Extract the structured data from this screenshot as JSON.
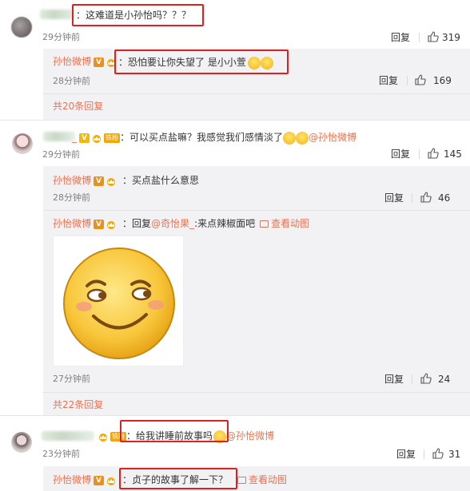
{
  "comments": [
    {
      "text": "：这难道是小孙怡吗？？？",
      "time": "29分钟前",
      "reply_label": "回复",
      "likes": "319",
      "replies": [
        {
          "user": "孙怡微博",
          "text": "：恐怕要让你失望了 是小小萱",
          "time": "28分钟前",
          "reply_label": "回复",
          "likes": "169"
        }
      ],
      "more_replies": "共20条回复"
    },
    {
      "username_suffix": "_",
      "fan_badge": "铁粉",
      "text": "：可以买点盐嘛？我感觉我们感情淡了",
      "mention": "@孙怡微博",
      "time": "29分钟前",
      "reply_label": "回复",
      "likes": "145",
      "replies": [
        {
          "user": "孙怡微博",
          "text": "：买点盐什么意思",
          "time": "28分钟前",
          "reply_label": "回复",
          "likes": "46"
        },
        {
          "user": "孙怡微博",
          "text_prefix": "：回复",
          "mention": "@奇怡果_",
          "text": ":来点辣椒面吧",
          "view_image": "查看动图",
          "time": "27分钟前",
          "reply_label": "回复",
          "likes": "24"
        }
      ],
      "more_replies": "共22条回复"
    },
    {
      "fan_badge": "铁粉",
      "text": "：给我讲睡前故事吗",
      "mention": "@孙怡微博",
      "time": "23分钟前",
      "reply_label": "回复",
      "likes": "31",
      "replies": [
        {
          "user": "孙怡微博",
          "text": "：贞子的故事了解一下？",
          "view_image": "查看动图"
        }
      ]
    }
  ],
  "badges": {
    "v_label": "V"
  },
  "colors": {
    "link": "#eb7350",
    "highlight": "#e0201f",
    "sub_bg": "#f2f2f5"
  }
}
